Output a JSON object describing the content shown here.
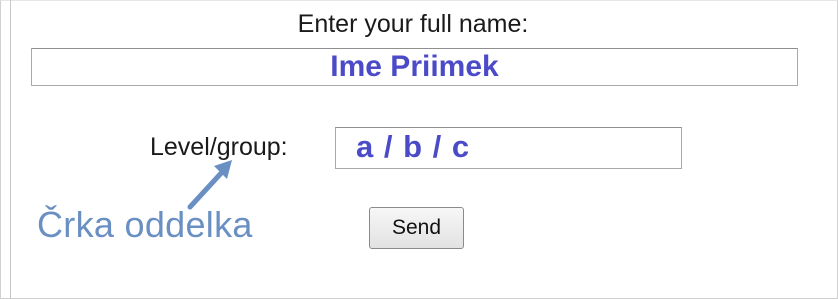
{
  "form": {
    "name_label": "Enter your full name:",
    "name_value": "Ime Priimek",
    "level_label": "Level/group:",
    "level_value": "a / b / c",
    "send_label": "Send"
  },
  "annotation": {
    "text": "Črka oddelka",
    "color": "#6a8fc2"
  },
  "colors": {
    "input_text": "#4b4bc8"
  },
  "icons": {
    "annotation_arrow": "arrow-up-right-icon"
  }
}
